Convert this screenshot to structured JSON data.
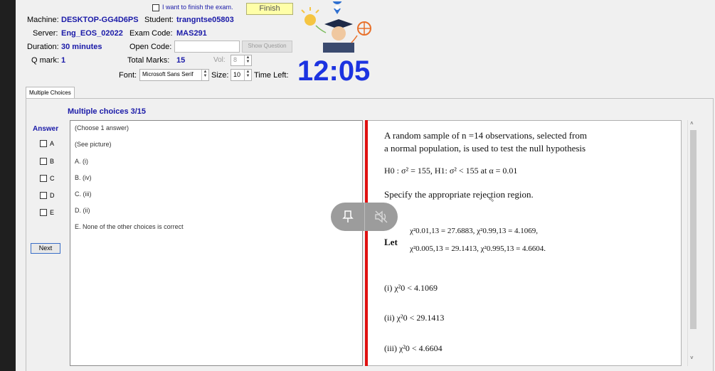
{
  "header": {
    "finish_check_label": "I want to finish the exam.",
    "finish_button": "Finish",
    "machine_label": "Machine:",
    "machine_value": "DESKTOP-GG4D6PS",
    "student_label": "Student:",
    "student_value": "trangntse05803",
    "server_label": "Server:",
    "server_value": "Eng_EOS_02022",
    "exam_code_label": "Exam Code:",
    "exam_code_value": "MAS291",
    "duration_label": "Duration:",
    "duration_value": "30 minutes",
    "open_code_label": "Open Code:",
    "open_code_value": "",
    "show_question_button": "Show Question",
    "qmark_label": "Q mark:",
    "qmark_value": "1",
    "total_marks_label": "Total Marks:",
    "total_marks_value": "15",
    "vol_label": "Vol:",
    "vol_value": "8",
    "font_label": "Font:",
    "font_value": "Microsoft Sans Serif",
    "size_label": "Size:",
    "size_value": "10",
    "time_left_label": "Time Left:",
    "timer": "12:05"
  },
  "tab": "Multiple Choices",
  "question": {
    "title": "Multiple choices 3/15",
    "answer_label": "Answer",
    "choice_letters": [
      "A",
      "B",
      "C",
      "D",
      "E"
    ],
    "next_button": "Next",
    "options": [
      "(Choose 1 answer)",
      "(See picture)",
      "A. (i)",
      "B. (iv)",
      "C. (iii)",
      "D. (ii)",
      "E. None of the other choices is correct"
    ]
  },
  "problem": {
    "line1": "A random sample of n =14 observations, selected from",
    "line2": "a normal population, is used to test the null hypothesis",
    "hypothesis": "H0 : σ² = 155, H1: σ² < 155 at α = 0.01",
    "specify": "Specify the appropriate rejection region.",
    "let": "Let",
    "chi_line1": "χ²0.01,13 = 27.6883, χ²0.99,13 = 4.1069,",
    "chi_line2": "χ²0.005,13 = 29.1413, χ²0.995,13 = 4.6604.",
    "choice_i": "(i)  χ²0 < 4.1069",
    "choice_ii": "(ii)  χ²0 < 29.1413",
    "choice_iii": "(iii)  χ²0 < 4.6604"
  }
}
